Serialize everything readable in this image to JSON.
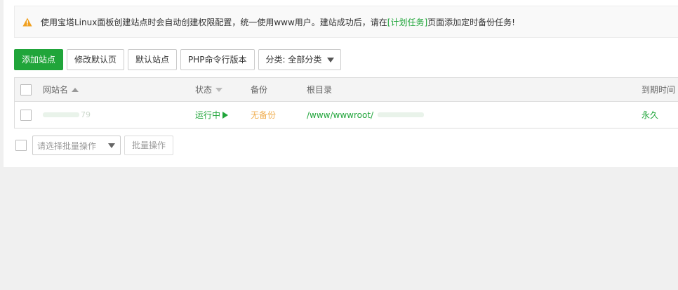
{
  "notice": {
    "text_before": "使用宝塔Linux面板创建站点时会自动创建权限配置，统一使用www用户。建站成功后，请在",
    "link": "[计划任务]",
    "text_after": "页面添加定时备份任务!"
  },
  "toolbar": {
    "add_site": "添加站点",
    "modify_default_page": "修改默认页",
    "default_site": "默认站点",
    "php_cli_version": "PHP命令行版本",
    "category_select": "分类: 全部分类"
  },
  "table": {
    "headers": {
      "site_name": "网站名",
      "status": "状态",
      "backup": "备份",
      "root_dir": "根目录",
      "expire": "到期时间"
    },
    "rows": [
      {
        "site_name_visible": "79",
        "status": "运行中",
        "backup": "无备份",
        "root_dir": "/www/wwwroot/",
        "expire": "永久"
      }
    ]
  },
  "batch": {
    "select_placeholder": "请选择批量操作",
    "button": "批量操作"
  },
  "colors": {
    "primary_green": "#20a53a",
    "warning_orange": "#f0ad4e",
    "page_bg": "#f0f0f0"
  }
}
